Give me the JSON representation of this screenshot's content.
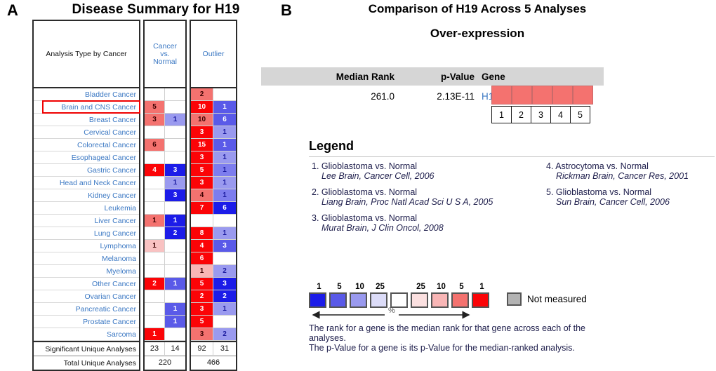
{
  "panelA": {
    "letter": "A",
    "title": "Disease Summary for H19",
    "headers": {
      "label": "Analysis Type by Cancer",
      "cancer_vs_normal": "Cancer\nvs.\nNormal",
      "cvn_line1": "Cancer",
      "cvn_line2": "vs.",
      "cvn_line3": "Normal",
      "outlier": "Outlier"
    },
    "rows": [
      {
        "label": "Bladder Cancer",
        "highlight": false,
        "cvn_up": "",
        "cvn_up_color": "#ffffff",
        "cvn_dn": "",
        "cvn_dn_color": "#ffffff",
        "out_up": "2",
        "out_up_color": "#f4726f",
        "out_dn": "",
        "out_dn_color": "#ffffff"
      },
      {
        "label": "Brain and CNS Cancer",
        "highlight": true,
        "cvn_up": "5",
        "cvn_up_color": "#f4726f",
        "cvn_dn": "",
        "cvn_dn_color": "#ffffff",
        "out_up": "10",
        "out_up_color": "#fb0407",
        "out_dn": "1",
        "out_dn_color": "#5a5ae8"
      },
      {
        "label": "Breast Cancer",
        "highlight": false,
        "cvn_up": "3",
        "cvn_up_color": "#f4726f",
        "cvn_dn": "1",
        "cvn_dn_color": "#9a9aef",
        "out_up": "10",
        "out_up_color": "#f4726f",
        "out_dn": "6",
        "out_dn_color": "#5a5ae8"
      },
      {
        "label": "Cervical Cancer",
        "highlight": false,
        "cvn_up": "",
        "cvn_up_color": "#ffffff",
        "cvn_dn": "",
        "cvn_dn_color": "#ffffff",
        "out_up": "3",
        "out_up_color": "#fb0407",
        "out_dn": "1",
        "out_dn_color": "#9a9aef"
      },
      {
        "label": "Colorectal Cancer",
        "highlight": false,
        "cvn_up": "6",
        "cvn_up_color": "#f4726f",
        "cvn_dn": "",
        "cvn_dn_color": "#ffffff",
        "out_up": "15",
        "out_up_color": "#fb0407",
        "out_dn": "1",
        "out_dn_color": "#5a5ae8"
      },
      {
        "label": "Esophageal Cancer",
        "highlight": false,
        "cvn_up": "",
        "cvn_up_color": "#ffffff",
        "cvn_dn": "",
        "cvn_dn_color": "#ffffff",
        "out_up": "3",
        "out_up_color": "#fb0407",
        "out_dn": "1",
        "out_dn_color": "#9a9aef"
      },
      {
        "label": "Gastric Cancer",
        "highlight": false,
        "cvn_up": "4",
        "cvn_up_color": "#fb0407",
        "cvn_dn": "3",
        "cvn_dn_color": "#1c1ce8",
        "out_up": "5",
        "out_up_color": "#fb0407",
        "out_dn": "1",
        "out_dn_color": "#7d7dee"
      },
      {
        "label": "Head and Neck Cancer",
        "highlight": false,
        "cvn_up": "",
        "cvn_up_color": "#ffffff",
        "cvn_dn": "1",
        "cvn_dn_color": "#9a9aef",
        "out_up": "3",
        "out_up_color": "#fb0407",
        "out_dn": "1",
        "out_dn_color": "#9a9aef"
      },
      {
        "label": "Kidney Cancer",
        "highlight": false,
        "cvn_up": "",
        "cvn_up_color": "#ffffff",
        "cvn_dn": "3",
        "cvn_dn_color": "#1c1ce8",
        "out_up": "4",
        "out_up_color": "#f4726f",
        "out_dn": "1",
        "out_dn_color": "#7d7dee"
      },
      {
        "label": "Leukemia",
        "highlight": false,
        "cvn_up": "",
        "cvn_up_color": "#ffffff",
        "cvn_dn": "",
        "cvn_dn_color": "#ffffff",
        "out_up": "7",
        "out_up_color": "#fb0407",
        "out_dn": "6",
        "out_dn_color": "#1c1ce8"
      },
      {
        "label": "Liver Cancer",
        "highlight": false,
        "cvn_up": "1",
        "cvn_up_color": "#f4726f",
        "cvn_dn": "1",
        "cvn_dn_color": "#1c1ce8",
        "out_up": "",
        "out_up_color": "#ffffff",
        "out_dn": "",
        "out_dn_color": "#ffffff"
      },
      {
        "label": "Lung Cancer",
        "highlight": false,
        "cvn_up": "",
        "cvn_up_color": "#ffffff",
        "cvn_dn": "2",
        "cvn_dn_color": "#1c1ce8",
        "out_up": "8",
        "out_up_color": "#fb0407",
        "out_dn": "1",
        "out_dn_color": "#9a9aef"
      },
      {
        "label": "Lymphoma",
        "highlight": false,
        "cvn_up": "1",
        "cvn_up_color": "#f9c2c2",
        "cvn_dn": "",
        "cvn_dn_color": "#ffffff",
        "out_up": "4",
        "out_up_color": "#fb0407",
        "out_dn": "3",
        "out_dn_color": "#5a5ae8"
      },
      {
        "label": "Melanoma",
        "highlight": false,
        "cvn_up": "",
        "cvn_up_color": "#ffffff",
        "cvn_dn": "",
        "cvn_dn_color": "#ffffff",
        "out_up": "6",
        "out_up_color": "#fb0407",
        "out_dn": "",
        "out_dn_color": "#ffffff"
      },
      {
        "label": "Myeloma",
        "highlight": false,
        "cvn_up": "",
        "cvn_up_color": "#ffffff",
        "cvn_dn": "",
        "cvn_dn_color": "#ffffff",
        "out_up": "1",
        "out_up_color": "#f9b6b6",
        "out_dn": "2",
        "out_dn_color": "#9a9aef"
      },
      {
        "label": "Other Cancer",
        "highlight": false,
        "cvn_up": "2",
        "cvn_up_color": "#fb0407",
        "cvn_dn": "1",
        "cvn_dn_color": "#5a5ae8",
        "out_up": "5",
        "out_up_color": "#fb0407",
        "out_dn": "3",
        "out_dn_color": "#1c1ce8"
      },
      {
        "label": "Ovarian Cancer",
        "highlight": false,
        "cvn_up": "",
        "cvn_up_color": "#ffffff",
        "cvn_dn": "",
        "cvn_dn_color": "#ffffff",
        "out_up": "2",
        "out_up_color": "#fb0407",
        "out_dn": "2",
        "out_dn_color": "#1c1ce8"
      },
      {
        "label": "Pancreatic Cancer",
        "highlight": false,
        "cvn_up": "",
        "cvn_up_color": "#ffffff",
        "cvn_dn": "1",
        "cvn_dn_color": "#5a5ae8",
        "out_up": "3",
        "out_up_color": "#fb0407",
        "out_dn": "1",
        "out_dn_color": "#9a9aef"
      },
      {
        "label": "Prostate Cancer",
        "highlight": false,
        "cvn_up": "",
        "cvn_up_color": "#ffffff",
        "cvn_dn": "1",
        "cvn_dn_color": "#5a5ae8",
        "out_up": "5",
        "out_up_color": "#fb0407",
        "out_dn": "",
        "out_dn_color": "#ffffff"
      },
      {
        "label": "Sarcoma",
        "highlight": false,
        "cvn_up": "1",
        "cvn_up_color": "#fb0407",
        "cvn_dn": "",
        "cvn_dn_color": "#ffffff",
        "out_up": "3",
        "out_up_color": "#f4726f",
        "out_dn": "2",
        "out_dn_color": "#9a9aef"
      }
    ],
    "summary": {
      "significant_label": "Significant Unique Analyses",
      "sig_cvn_up": "23",
      "sig_cvn_dn": "14",
      "sig_out_up": "92",
      "sig_out_dn": "31",
      "total_label": "Total Unique Analyses",
      "total_cvn": "220",
      "total_out": "466"
    }
  },
  "panelB": {
    "letter": "B",
    "title": "Comparison of H19 Across 5 Analyses",
    "subtitle": "Over-expression",
    "table": {
      "col_median_rank": "Median Rank",
      "col_pvalue": "p-Value",
      "col_gene": "Gene",
      "median_rank": "261.0",
      "pvalue": "2.13E-11",
      "gene": "H19",
      "cell_color": "#f4726f",
      "analysis_numbers": [
        "1",
        "2",
        "3",
        "4",
        "5"
      ]
    },
    "legend": {
      "title": "Legend",
      "left": [
        {
          "line1": "1. Glioblastoma vs. Normal",
          "line2": "Lee Brain, Cancer Cell, 2006"
        },
        {
          "line1": "2. Glioblastoma vs. Normal",
          "line2": "Liang Brain, Proc Natl Acad Sci U S A, 2005"
        },
        {
          "line1": "3. Glioblastoma vs. Normal",
          "line2": "Murat Brain, J Clin Oncol, 2008"
        }
      ],
      "right": [
        {
          "line1": "4. Astrocytoma vs. Normal",
          "line2": "Rickman Brain, Cancer Res, 2001"
        },
        {
          "line1": "5. Glioblastoma vs. Normal",
          "line2": "Sun Brain, Cancer Cell, 2006"
        }
      ]
    },
    "scale": {
      "labels": [
        "1",
        "5",
        "10",
        "25",
        "",
        "25",
        "10",
        "5",
        "1"
      ],
      "colors": [
        "#1c1ce8",
        "#5a5ae8",
        "#9a9aef",
        "#dcdcf8",
        "#ffffff",
        "#fbe0e0",
        "#f9b6b6",
        "#f4726f",
        "#fb0407"
      ],
      "percent_label": "%",
      "not_measured": "Not measured",
      "not_measured_color": "#b3b3b3"
    },
    "footnote_line1": "The rank for a gene is the median rank for that gene across each of the",
    "footnote_line2": "analyses.",
    "footnote_line3": "The p-Value for a gene is its p-Value for the median-ranked analysis."
  }
}
